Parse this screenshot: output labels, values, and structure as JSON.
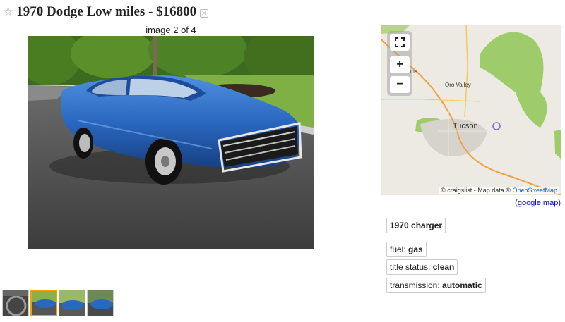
{
  "title": "1970 Dodge Low miles - $16800",
  "counter": "image 2 of 4",
  "map": {
    "city_main": "Tucson",
    "city_secondary": "Oro Valley",
    "city_partial": "ana",
    "zoom_in": "+",
    "zoom_out": "−",
    "attribution_prefix": "© craigslist - Map data ©",
    "attribution_link": "OpenStreetMap"
  },
  "google_map": {
    "open": "(",
    "link": "google map",
    "close": ")"
  },
  "attrgroup": {
    "headline": "1970 charger",
    "items": [
      {
        "label": "fuel: ",
        "value": "gas"
      },
      {
        "label": "title status: ",
        "value": "clean"
      },
      {
        "label": "transmission: ",
        "value": "automatic"
      }
    ]
  },
  "colors": {
    "car_blue": "#2a68c0",
    "selected_thumb_border": "#f0a000",
    "link_blue": "#0000ee"
  }
}
